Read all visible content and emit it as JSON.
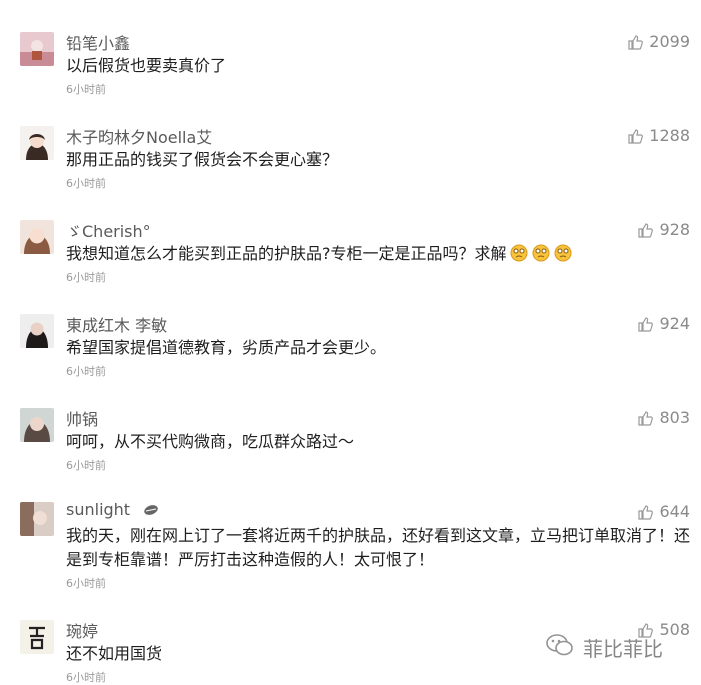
{
  "time_label": "6小时前",
  "comments": [
    {
      "username": "铅笔小鑫",
      "text": "以后假货也要卖真价了",
      "time": "6小时前",
      "likes": "2099"
    },
    {
      "username": "木子昀林夕Noella艾",
      "text": "那用正品的钱买了假货会不会更心塞？",
      "time": "6小时前",
      "likes": "1288"
    },
    {
      "username": "ゞCherish°",
      "text": "我想知道怎么才能买到正品的护肤品?专柜一定是正品吗？求解",
      "time": "6小时前",
      "likes": "928"
    },
    {
      "username": "東成红木 李敏",
      "text": "希望国家提倡道德教育，劣质产品才会更少。",
      "time": "6小时前",
      "likes": "924"
    },
    {
      "username": "帅锅",
      "text": "呵呵，从不买代购微商，吃瓜群众路过～",
      "time": "6小时前",
      "likes": "803"
    },
    {
      "username": "sunlight",
      "text": "我的天，刚在网上订了一套将近两千的护肤品，还好看到这文章，立马把订单取消了！还是到专柜靠谱！严厉打击这种造假的人！太可恨了！",
      "time": "6小时前",
      "likes": "644"
    },
    {
      "username": "琬婷",
      "text": "还不如用国货",
      "time": "6小时前",
      "likes": "508"
    }
  ],
  "watermark": {
    "text": "菲比菲比",
    "icon": "wechat-icon"
  },
  "colors": {
    "text": "#1e1e1e",
    "name": "#5a5a5a",
    "meta": "#9a9a9a"
  }
}
